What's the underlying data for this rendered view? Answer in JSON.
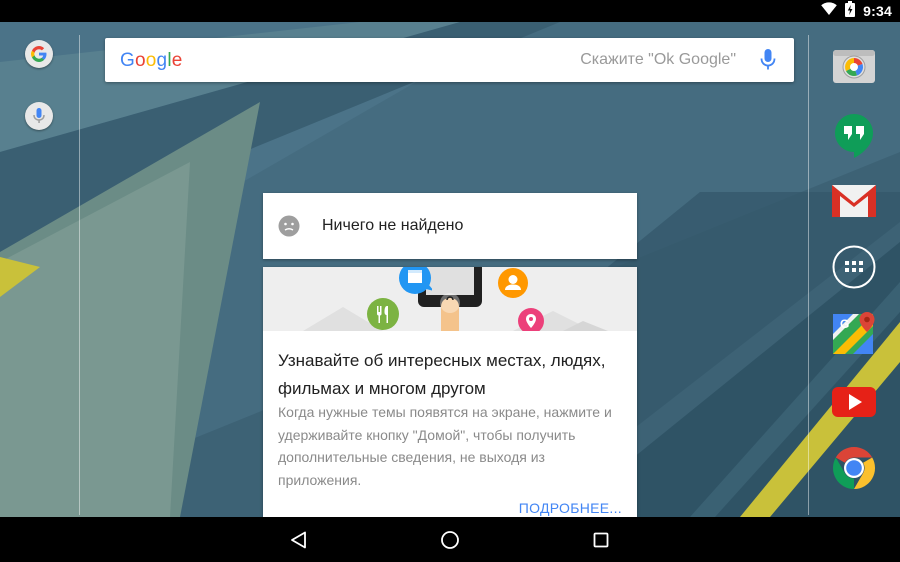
{
  "status_bar": {
    "time": "9:34",
    "icons": [
      "wifi-icon",
      "battery-icon"
    ]
  },
  "search": {
    "brand": [
      "G",
      "o",
      "o",
      "g",
      "l",
      "e"
    ],
    "brand_colors": [
      "#4285f4",
      "#ea4335",
      "#fbbc05",
      "#4285f4",
      "#34a853",
      "#ea4335"
    ],
    "hint": "Скажите \"Ok Google\"",
    "mic_color": "#4285f4"
  },
  "left_column": {
    "icons": [
      "google-g-icon",
      "voice-search-icon"
    ]
  },
  "dock": {
    "apps": [
      "camera-icon",
      "hangouts-icon",
      "gmail-icon",
      "app-drawer-icon",
      "maps-icon",
      "youtube-icon",
      "chrome-icon"
    ]
  },
  "no_results_card": {
    "text": "Ничего не найдено",
    "icon": "sad-face-icon"
  },
  "info_card": {
    "title": "Узнавайте об интересных местах, людях, фильмах и многом другом",
    "body": "Когда нужные темы появятся на экране, нажмите и удерживайте кнопку \"Домой\", чтобы получить дополнительные сведения, не выходя из приложения.",
    "more_link": "ПОДРОБНЕЕ...",
    "illustration_icons": [
      "movie-icon",
      "person-icon",
      "restaurant-icon",
      "place-icon"
    ]
  },
  "nav_bar": {
    "buttons": [
      "back-icon",
      "home-icon",
      "recents-icon"
    ]
  },
  "colors": {
    "wallpaper_base": "#3f6478",
    "accent_yellow": "#c9c13a",
    "link_blue": "#4285f4"
  }
}
